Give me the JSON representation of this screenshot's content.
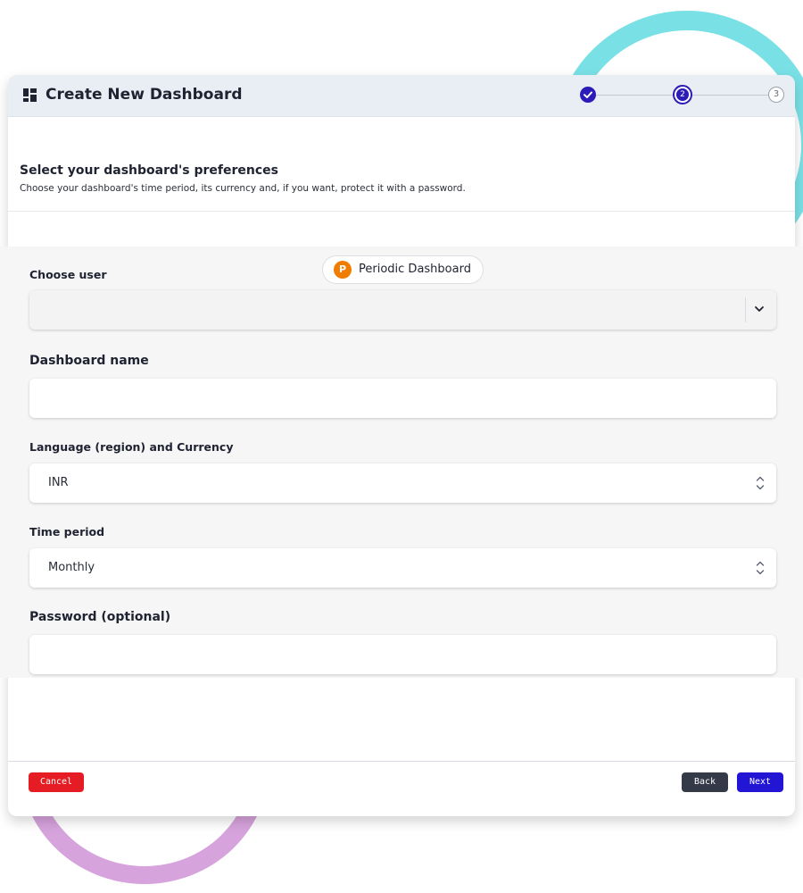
{
  "window": {
    "title": "Create New Dashboard"
  },
  "stepper": {
    "steps": [
      {
        "label": "✓",
        "state": "completed"
      },
      {
        "label": "2",
        "state": "active"
      },
      {
        "label": "3",
        "state": "pending"
      }
    ],
    "accent_color": "#2b1bb8"
  },
  "section": {
    "heading": "Select your dashboard's preferences",
    "description": "Choose your dashboard's time period, its currency and, if you want, protect it with a password."
  },
  "badge": {
    "letter": "P",
    "label": "Periodic Dashboard",
    "color": "#f07d00"
  },
  "form": {
    "choose_user": {
      "label": "Choose user",
      "value": "",
      "icon": "chevron-down-icon"
    },
    "dashboard_name": {
      "label": "Dashboard name",
      "value": ""
    },
    "language_currency": {
      "label": "Language (region) and Currency",
      "value": "INR",
      "icon": "up-down-chevron-icon"
    },
    "time_period": {
      "label": "Time period",
      "value": "Monthly",
      "icon": "up-down-chevron-icon"
    },
    "password": {
      "label": "Password (optional)",
      "value": ""
    }
  },
  "footer": {
    "cancel_label": "Cancel",
    "back_label": "Back",
    "next_label": "Next",
    "cancel_color": "#e51c23",
    "back_color": "#343a48",
    "next_color": "#2315d4"
  }
}
